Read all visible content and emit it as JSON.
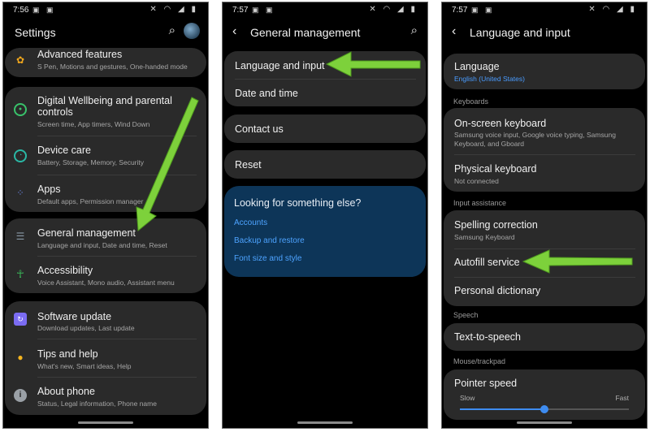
{
  "status": {
    "p1_time": "7:56",
    "p2_time": "7:57",
    "p3_time": "7:57",
    "left_icons": "▣ ▣",
    "right_icons": "✕ ◠ ◢ ▮"
  },
  "settings": {
    "title": "Settings",
    "items": [
      {
        "title": "Advanced features",
        "subtitle": "S Pen, Motions and gestures, One-handed mode",
        "icon": "gear-icon",
        "color": "#f2a81d"
      },
      {
        "title": "Digital Wellbeing and parental",
        "title2": "controls",
        "subtitle": "Screen time, App timers, Wind Down",
        "icon": "wellbeing-icon",
        "color": "#39c36b"
      },
      {
        "title": "Device care",
        "subtitle": "Battery, Storage, Memory, Security",
        "icon": "device-care-icon",
        "color": "#2ab8a5"
      },
      {
        "title": "Apps",
        "subtitle": "Default apps, Permission manager",
        "icon": "apps-icon",
        "color": "#6f8cf0"
      },
      {
        "title": "General management",
        "subtitle": "Language and input, Date and time, Reset",
        "icon": "sliders-icon",
        "color": "#8a9aa8"
      },
      {
        "title": "Accessibility",
        "subtitle": "Voice Assistant, Mono audio, Assistant menu",
        "icon": "accessibility-icon",
        "color": "#3bbf5c"
      },
      {
        "title": "Software update",
        "subtitle": "Download updates, Last update",
        "icon": "update-icon",
        "color": "#7b6cf2"
      },
      {
        "title": "Tips and help",
        "subtitle": "What's new, Smart ideas, Help",
        "icon": "bulb-icon",
        "color": "#f5b51f"
      },
      {
        "title": "About phone",
        "subtitle": "Status, Legal information, Phone name",
        "icon": "info-icon",
        "color": "#9aa0a6"
      }
    ]
  },
  "general": {
    "title": "General management",
    "items": [
      "Language and input",
      "Date and time",
      "Contact us",
      "Reset"
    ],
    "looking": {
      "heading": "Looking for something else?",
      "links": [
        "Accounts",
        "Backup and restore",
        "Font size and style"
      ]
    }
  },
  "language": {
    "title": "Language and input",
    "language_label": "Language",
    "language_value": "English (United States)",
    "sections": {
      "keyboards": "Keyboards",
      "input_assistance": "Input assistance",
      "speech": "Speech",
      "mouse": "Mouse/trackpad"
    },
    "onscreen": {
      "title": "On-screen keyboard",
      "subtitle1": "Samsung voice input, Google voice typing, Samsung",
      "subtitle2": "Keyboard, and Gboard"
    },
    "physical": {
      "title": "Physical keyboard",
      "subtitle": "Not connected"
    },
    "spelling": {
      "title": "Spelling correction",
      "subtitle": "Samsung Keyboard"
    },
    "autofill": "Autofill service",
    "dictionary": "Personal dictionary",
    "tts": "Text-to-speech",
    "pointer": {
      "title": "Pointer speed",
      "slow": "Slow",
      "fast": "Fast",
      "level": 0.5
    }
  },
  "colors": {
    "arrow": "#7dd13b",
    "link": "#4da3ff",
    "card": "#2a2a2a",
    "looking_bg": "#0d3558"
  }
}
